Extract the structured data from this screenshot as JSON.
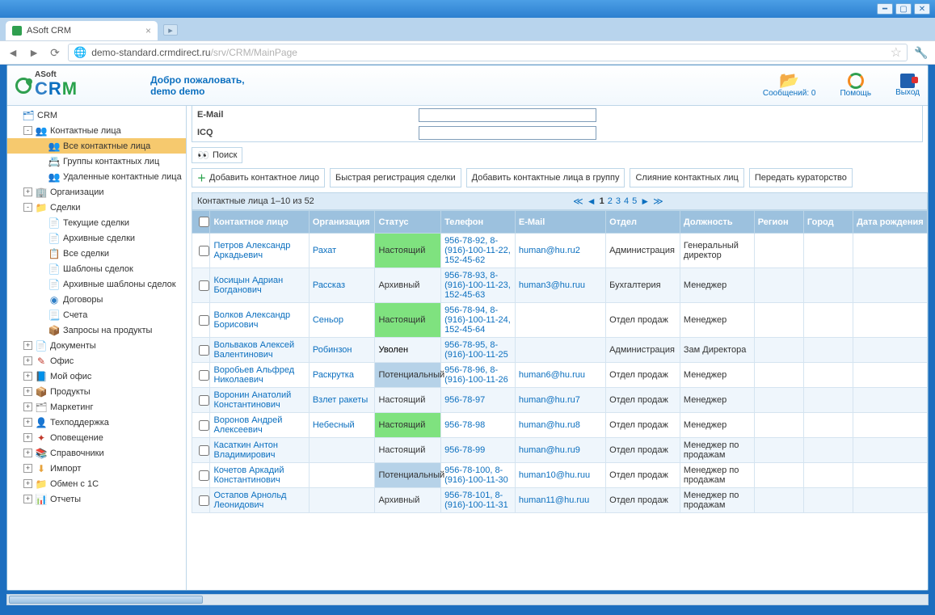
{
  "window": {
    "tab_title": "ASoft CRM",
    "url_main": "demo-standard.crmdirect.ru",
    "url_path": "/srv/CRM/MainPage"
  },
  "header": {
    "welcome_line1": "Добро пожаловать,",
    "welcome_line2": "demo demo",
    "messages_label": "Сообщений: 0",
    "help_label": "Помощь",
    "exit_label": "Выход"
  },
  "sidebar": {
    "root": "CRM",
    "items": [
      {
        "label": "Контактные лица",
        "exp": "-",
        "depth": 2,
        "icon": "👥",
        "cls": "ico-folder"
      },
      {
        "label": "Все контактные лица",
        "depth": 3,
        "icon": "👥",
        "cls": "ico-folder",
        "active": true
      },
      {
        "label": "Группы контактных лиц",
        "depth": 3,
        "icon": "📇",
        "cls": "ico-grey"
      },
      {
        "label": "Удаленные контактные лица",
        "depth": 3,
        "icon": "👥",
        "cls": "ico-folder"
      },
      {
        "label": "Организации",
        "exp": "+",
        "depth": 2,
        "icon": "🏢",
        "cls": "ico-folder"
      },
      {
        "label": "Сделки",
        "exp": "-",
        "depth": 2,
        "icon": "📁",
        "cls": "ico-folder"
      },
      {
        "label": "Текущие сделки",
        "depth": 3,
        "icon": "📄",
        "cls": "ico-doc"
      },
      {
        "label": "Архивные сделки",
        "depth": 3,
        "icon": "📄",
        "cls": "ico-purple"
      },
      {
        "label": "Все сделки",
        "depth": 3,
        "icon": "📋",
        "cls": "ico-grey"
      },
      {
        "label": "Шаблоны сделок",
        "depth": 3,
        "icon": "📄",
        "cls": "ico-green"
      },
      {
        "label": "Архивные шаблоны сделок",
        "depth": 3,
        "icon": "📄",
        "cls": "ico-purple"
      },
      {
        "label": "Договоры",
        "depth": 3,
        "icon": "◉",
        "cls": "ico-doc"
      },
      {
        "label": "Счета",
        "depth": 3,
        "icon": "📃",
        "cls": "ico-grey"
      },
      {
        "label": "Запросы на продукты",
        "depth": 3,
        "icon": "📦",
        "cls": "ico-folder"
      },
      {
        "label": "Документы",
        "exp": "+",
        "depth": 2,
        "icon": "📄",
        "cls": "ico-grey"
      },
      {
        "label": "Офис",
        "exp": "+",
        "depth": 2,
        "icon": "✎",
        "cls": "ico-red"
      },
      {
        "label": "Мой офис",
        "exp": "+",
        "depth": 2,
        "icon": "📘",
        "cls": "ico-doc"
      },
      {
        "label": "Продукты",
        "exp": "+",
        "depth": 2,
        "icon": "📦",
        "cls": "ico-folder"
      },
      {
        "label": "Маркетинг",
        "exp": "+",
        "depth": 2,
        "icon": "🗂",
        "cls": "ico-grey"
      },
      {
        "label": "Техподдержка",
        "exp": "+",
        "depth": 2,
        "icon": "👤",
        "cls": "ico-folder"
      },
      {
        "label": "Оповещение",
        "exp": "+",
        "depth": 2,
        "icon": "✦",
        "cls": "ico-red"
      },
      {
        "label": "Справочники",
        "exp": "+",
        "depth": 2,
        "icon": "📚",
        "cls": "ico-green"
      },
      {
        "label": "Импорт",
        "exp": "+",
        "depth": 2,
        "icon": "⬇",
        "cls": "ico-folder"
      },
      {
        "label": "Обмен с 1С",
        "exp": "+",
        "depth": 2,
        "icon": "📁",
        "cls": "ico-folder"
      },
      {
        "label": "Отчеты",
        "exp": "+",
        "depth": 2,
        "icon": "📊",
        "cls": "ico-grey"
      }
    ]
  },
  "search": {
    "field1_label": "E-Mail",
    "field2_label": "ICQ",
    "search_btn": "Поиск"
  },
  "actions": [
    "Добавить контактное лицо",
    "Быстрая регистрация сделки",
    "Добавить контактные лица в группу",
    "Слияние контактных лиц",
    "Передать кураторство"
  ],
  "table": {
    "title": "Контактные лица 1–10 из 52",
    "pages": [
      "1",
      "2",
      "3",
      "4",
      "5"
    ],
    "current_page": "1",
    "columns": [
      "",
      "Контактное лицо",
      "Организация",
      "Статус",
      "Телефон",
      "E-Mail",
      "Отдел",
      "Должность",
      "Регион",
      "Город",
      "Дата рождения"
    ],
    "rows": [
      {
        "name": "Петров Александр Аркадьевич",
        "org": "Рахат",
        "status": "Настоящий",
        "stcls": "st-green",
        "phone": "956-78-92, 8-(916)-100-11-22, 152-45-62",
        "email": "human@hu.ru2",
        "dept": "Администрация",
        "pos": "Генеральный директор"
      },
      {
        "name": "Косицын Адриан Богданович",
        "org": "Рассказ",
        "status": "Архивный",
        "stcls": "st-pink",
        "phone": "956-78-93, 8-(916)-100-11-23, 152-45-63",
        "email": "human3@hu.ruu",
        "dept": "Бухгалтерия",
        "pos": "Менеджер"
      },
      {
        "name": "Волков Александр Борисович",
        "org": "Сеньор",
        "status": "Настоящий",
        "stcls": "st-green",
        "phone": "956-78-94, 8-(916)-100-11-24, 152-45-64",
        "email": "",
        "dept": "Отдел продаж",
        "pos": "Менеджер"
      },
      {
        "name": "Вольваков Алексей Валентинович",
        "org": "Робинзон",
        "status": "Уволен",
        "stcls": "st-red",
        "phone": "956-78-95, 8-(916)-100-11-25",
        "email": "",
        "dept": "Администрация",
        "pos": "Зам Директора"
      },
      {
        "name": "Воробьев Альфред Николаевич",
        "org": "Раскрутка",
        "status": "Потенциальный",
        "stcls": "st-blue",
        "phone": "956-78-96, 8-(916)-100-11-26",
        "email": "human6@hu.ruu",
        "dept": "Отдел продаж",
        "pos": "Менеджер"
      },
      {
        "name": "Воронин Анатолий Константинович",
        "org": "Взлет ракеты",
        "status": "Настоящий",
        "stcls": "st-green",
        "phone": "956-78-97",
        "email": "human@hu.ru7",
        "dept": "Отдел продаж",
        "pos": "Менеджер"
      },
      {
        "name": "Воронов Андрей Алексеевич",
        "org": "Небесный",
        "status": "Настоящий",
        "stcls": "st-green",
        "phone": "956-78-98",
        "email": "human@hu.ru8",
        "dept": "Отдел продаж",
        "pos": "Менеджер"
      },
      {
        "name": "Касаткин Антон Владимирович",
        "org": "",
        "status": "Настоящий",
        "stcls": "st-green",
        "phone": "956-78-99",
        "email": "human@hu.ru9",
        "dept": "Отдел продаж",
        "pos": "Менеджер по продажам"
      },
      {
        "name": "Кочетов Аркадий Константинович",
        "org": "",
        "status": "Потенциальный",
        "stcls": "st-blue",
        "phone": "956-78-100, 8-(916)-100-11-30",
        "email": "human10@hu.ruu",
        "dept": "Отдел продаж",
        "pos": "Менеджер по продажам"
      },
      {
        "name": "Остапов Арнольд Леонидович",
        "org": "",
        "status": "Архивный",
        "stcls": "st-pink",
        "phone": "956-78-101, 8-(916)-100-11-31",
        "email": "human11@hu.ruu",
        "dept": "Отдел продаж",
        "pos": "Менеджер по продажам"
      }
    ]
  }
}
